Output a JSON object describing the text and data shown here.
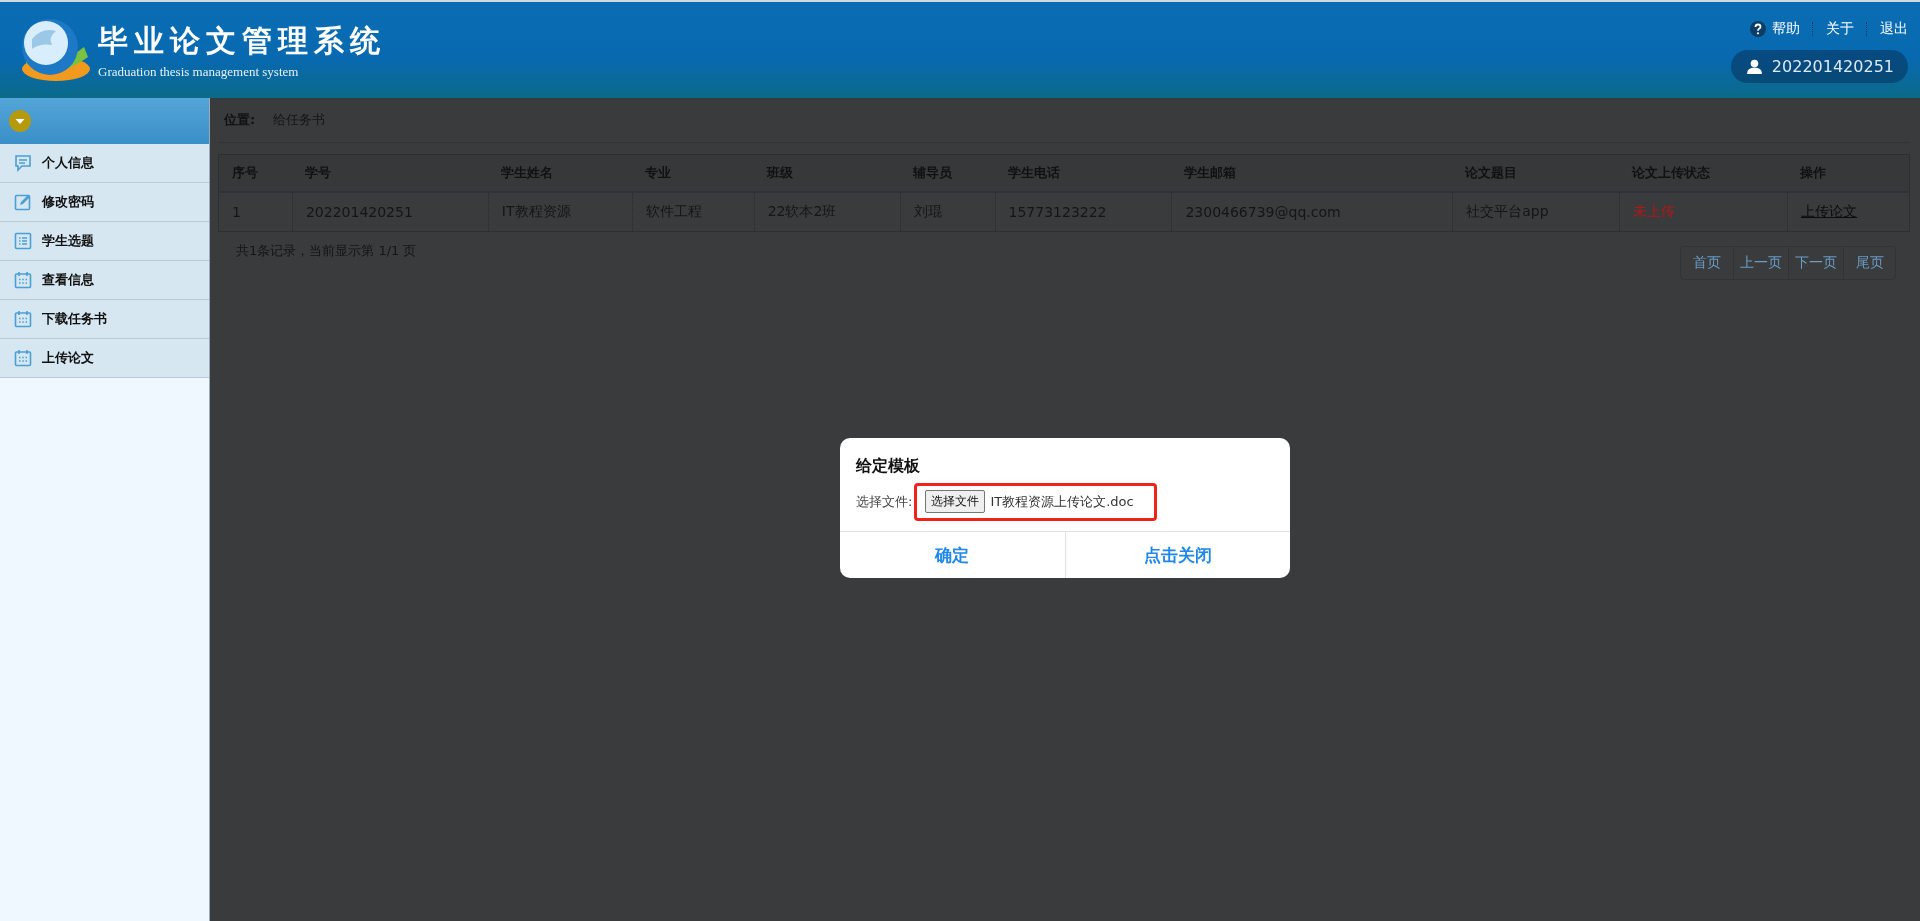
{
  "header": {
    "title": "毕业论文管理系统",
    "subtitle": "Graduation thesis management system",
    "links": [
      {
        "label": "帮助",
        "kind": "help"
      },
      {
        "label": "关于",
        "kind": "plain"
      },
      {
        "label": "退出",
        "kind": "plain"
      }
    ],
    "user": "202201420251"
  },
  "sidebar": {
    "items": [
      {
        "label": "个人信息",
        "kind": "chat"
      },
      {
        "label": "修改密码",
        "kind": "edit"
      },
      {
        "label": "学生选题",
        "kind": "list"
      },
      {
        "label": "查看信息",
        "kind": "calendar"
      },
      {
        "label": "下载任务书",
        "kind": "calendar"
      },
      {
        "label": "上传论文",
        "kind": "calendar"
      }
    ]
  },
  "location": {
    "label": "位置:",
    "value": "给任务书"
  },
  "table": {
    "columns": [
      "序号",
      "学号",
      "学生姓名",
      "专业",
      "班级",
      "辅导员",
      "学生电话",
      "学生邮箱",
      "论文题目",
      "论文上传状态",
      "操作"
    ],
    "rows": [
      {
        "cells": [
          {
            "text": "1",
            "kind": "plain"
          },
          {
            "text": "202201420251",
            "kind": "plain"
          },
          {
            "text": "IT教程资源",
            "kind": "plain"
          },
          {
            "text": "软件工程",
            "kind": "plain"
          },
          {
            "text": "22软本2班",
            "kind": "plain"
          },
          {
            "text": "刘琨",
            "kind": "plain"
          },
          {
            "text": "15773123222",
            "kind": "plain"
          },
          {
            "text": "2300466739@qq.com",
            "kind": "plain"
          },
          {
            "text": "社交平台app",
            "kind": "plain"
          },
          {
            "text": "未上传",
            "kind": "status"
          },
          {
            "text": "上传论文",
            "kind": "link"
          }
        ]
      }
    ]
  },
  "pagination": {
    "summary": "共1条记录，当前显示第 1/1 页",
    "buttons": [
      "首页",
      "上一页",
      "下一页",
      "尾页"
    ]
  },
  "dialog": {
    "title": "给定模板",
    "field_label": "选择文件:",
    "choose_button": "选择文件",
    "filename": "IT教程资源上传论文.doc",
    "highlighted": true,
    "buttons": [
      "确定",
      "点击关闭"
    ]
  }
}
